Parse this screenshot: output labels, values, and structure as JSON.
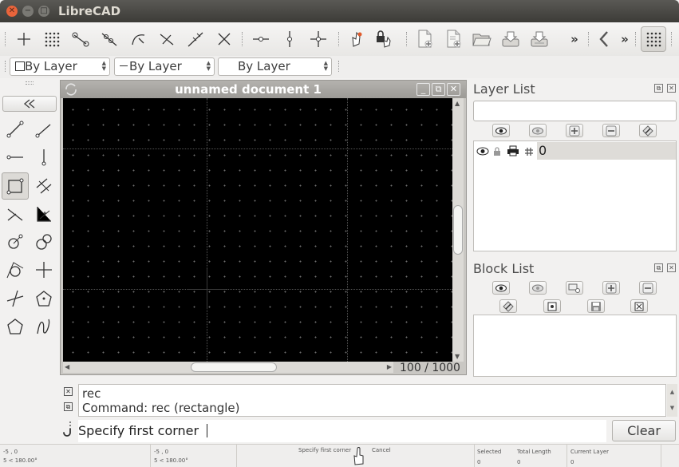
{
  "window": {
    "title": "LibreCAD"
  },
  "toolbar2": {
    "color_combo": "By Layer",
    "linetype_combo": "By Layer",
    "linewidth_combo": "By Layer"
  },
  "document": {
    "title": "unnamed document 1",
    "zoom_text": "100 / 1000"
  },
  "layer_list": {
    "title": "Layer List",
    "filter_placeholder": "",
    "layers": [
      {
        "name": "0"
      }
    ]
  },
  "block_list": {
    "title": "Block List"
  },
  "command": {
    "history_line1": "rec",
    "history_line2": "Command: rec (rectangle)",
    "prompt": "Specify first corner",
    "clear_label": "Clear"
  },
  "statusbar": {
    "abs_coord": "-5 , 0",
    "abs_polar": "5 < 180.00°",
    "rel_coord": "-5 , 0",
    "rel_polar": "5 < 180.00°",
    "mouse_left": "Specify first corner",
    "mouse_right": "Cancel",
    "selected_label": "Selected",
    "selected_value": "0",
    "total_length_label": "Total Length",
    "total_length_value": "0",
    "current_layer_label": "Current Layer",
    "current_layer_value": "0"
  },
  "icons": {
    "accent": "#e05a2b"
  }
}
